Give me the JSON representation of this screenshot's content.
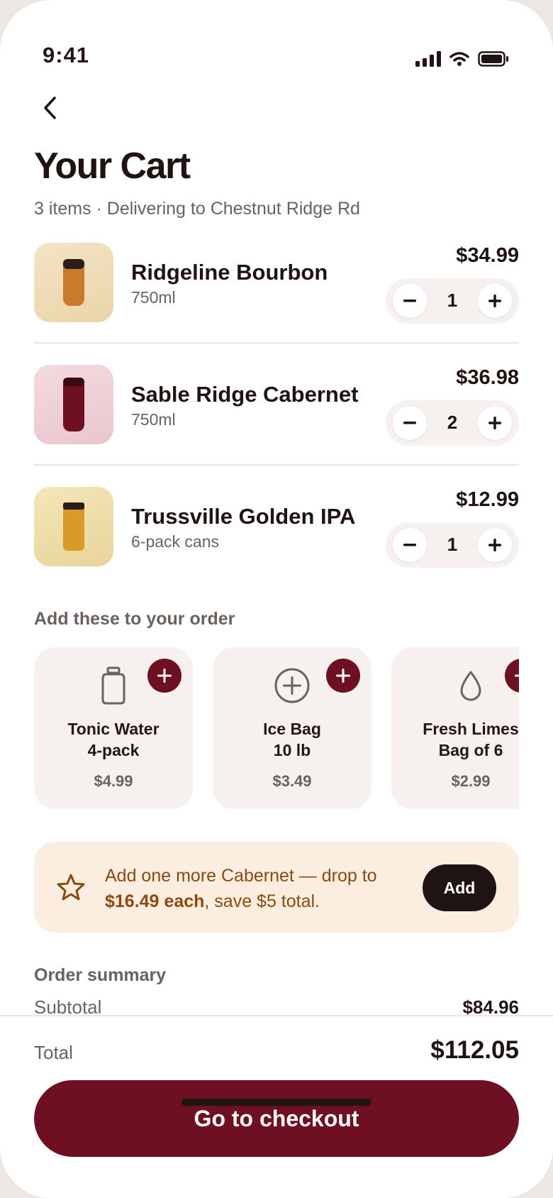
{
  "status": {
    "time": "9:41"
  },
  "header": {
    "title": "Your Cart",
    "subtitle": "3 items · Delivering to Chestnut Ridge Rd"
  },
  "cart": {
    "items": [
      {
        "name": "Ridgeline Bourbon",
        "size": "750ml",
        "price": "$34.99",
        "qty": "1",
        "thumb_bg": "#f2dfbd",
        "bottle_color": "#c97a2a"
      },
      {
        "name": "Sable Ridge Cabernet",
        "size": "750ml",
        "price": "$36.98",
        "qty": "2",
        "thumb_bg": "#f0d2d8",
        "bottle_color": "#6e0f22"
      },
      {
        "name": "Trussville Golden IPA",
        "size": "6-pack cans",
        "price": "$12.99",
        "qty": "1",
        "thumb_bg": "#f1e2ad",
        "bottle_color": "#d99a28"
      }
    ],
    "minus_icon": "minus-icon",
    "plus_icon": "plus-icon"
  },
  "upsell": {
    "title": "Add these to your order",
    "items": [
      {
        "name_line1": "Tonic Water",
        "name_line2": "4-pack",
        "price": "$4.99",
        "icon": "bottle-icon"
      },
      {
        "name_line1": "Ice Bag",
        "name_line2": "10 lb",
        "price": "$3.49",
        "icon": "plus-circle-icon"
      },
      {
        "name_line1": "Fresh Limes",
        "name_line2": "Bag of 6",
        "price": "$2.99",
        "icon": "drop-icon"
      }
    ]
  },
  "promo": {
    "text_before": "Add one more Cabernet — drop to ",
    "text_bold": "$16.49 each",
    "text_after": ", save $5 total.",
    "button": "Add",
    "icon": "star-icon"
  },
  "summary": {
    "title": "Order summary",
    "subtotal_label": "Subtotal",
    "subtotal_value": "$84.96"
  },
  "footer": {
    "total_label": "Total",
    "total_value": "$112.05",
    "checkout_label": "Go to checkout"
  },
  "colors": {
    "accent": "#6e0f22",
    "dark": "#1f1411",
    "muted": "#6b625e",
    "promo_bg": "#fbeee0",
    "card_bg": "#f6f0ee"
  }
}
